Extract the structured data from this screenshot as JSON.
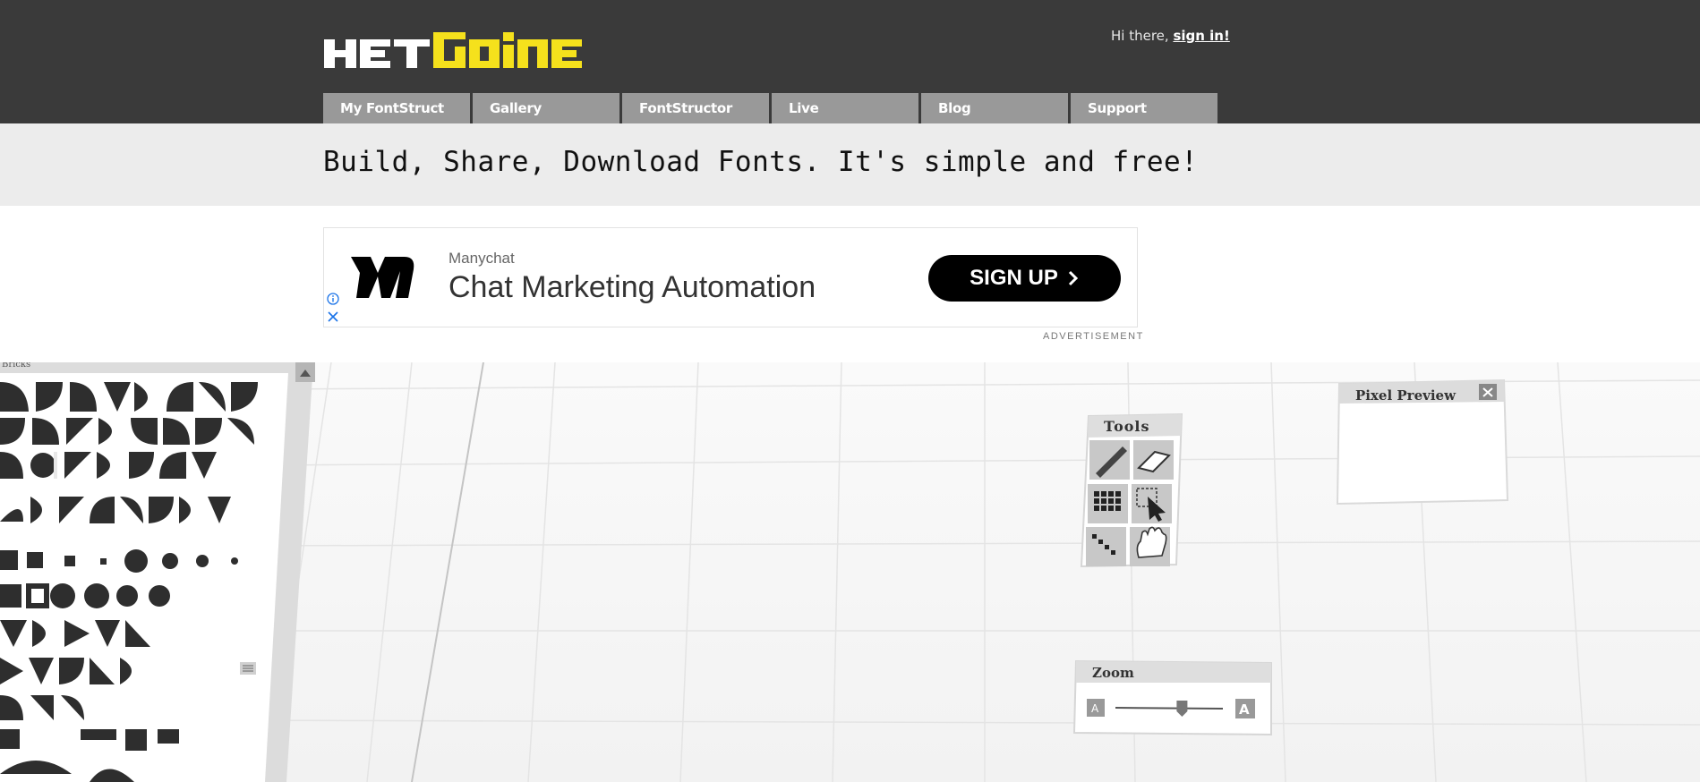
{
  "header": {
    "greeting": "Hi there, ",
    "sign_in": "sign in!",
    "logo_icon": "fontstruct-logo",
    "colors": {
      "bar": "#3a3a3a",
      "logo_white": "#ffffff",
      "logo_yellow": "#f5e11c",
      "tab": "#999999"
    }
  },
  "nav": {
    "tabs": [
      {
        "label": "My FontStruct"
      },
      {
        "label": "Gallery"
      },
      {
        "label": "FontStructor"
      },
      {
        "label": "Live"
      },
      {
        "label": "Blog"
      },
      {
        "label": "Support"
      }
    ]
  },
  "tagline": "Build, Share, Download Fonts. It's simple and free!",
  "ad": {
    "brand": "Manychat",
    "headline": "Chat Marketing Automation",
    "cta": "SIGN UP",
    "label": "ADVERTISEMENT",
    "icons": [
      "manychat-logo",
      "info-icon",
      "close-icon",
      "chevron-right-icon"
    ]
  },
  "editor": {
    "bricks_title": "Bricks",
    "tools_title": "Tools",
    "zoom_title": "Zoom",
    "zoom_level": 0.62,
    "preview_title": "Pixel Preview",
    "tools": [
      "pencil-icon",
      "eraser-icon",
      "grid-icon",
      "select-icon",
      "line-icon",
      "hand-icon"
    ]
  }
}
